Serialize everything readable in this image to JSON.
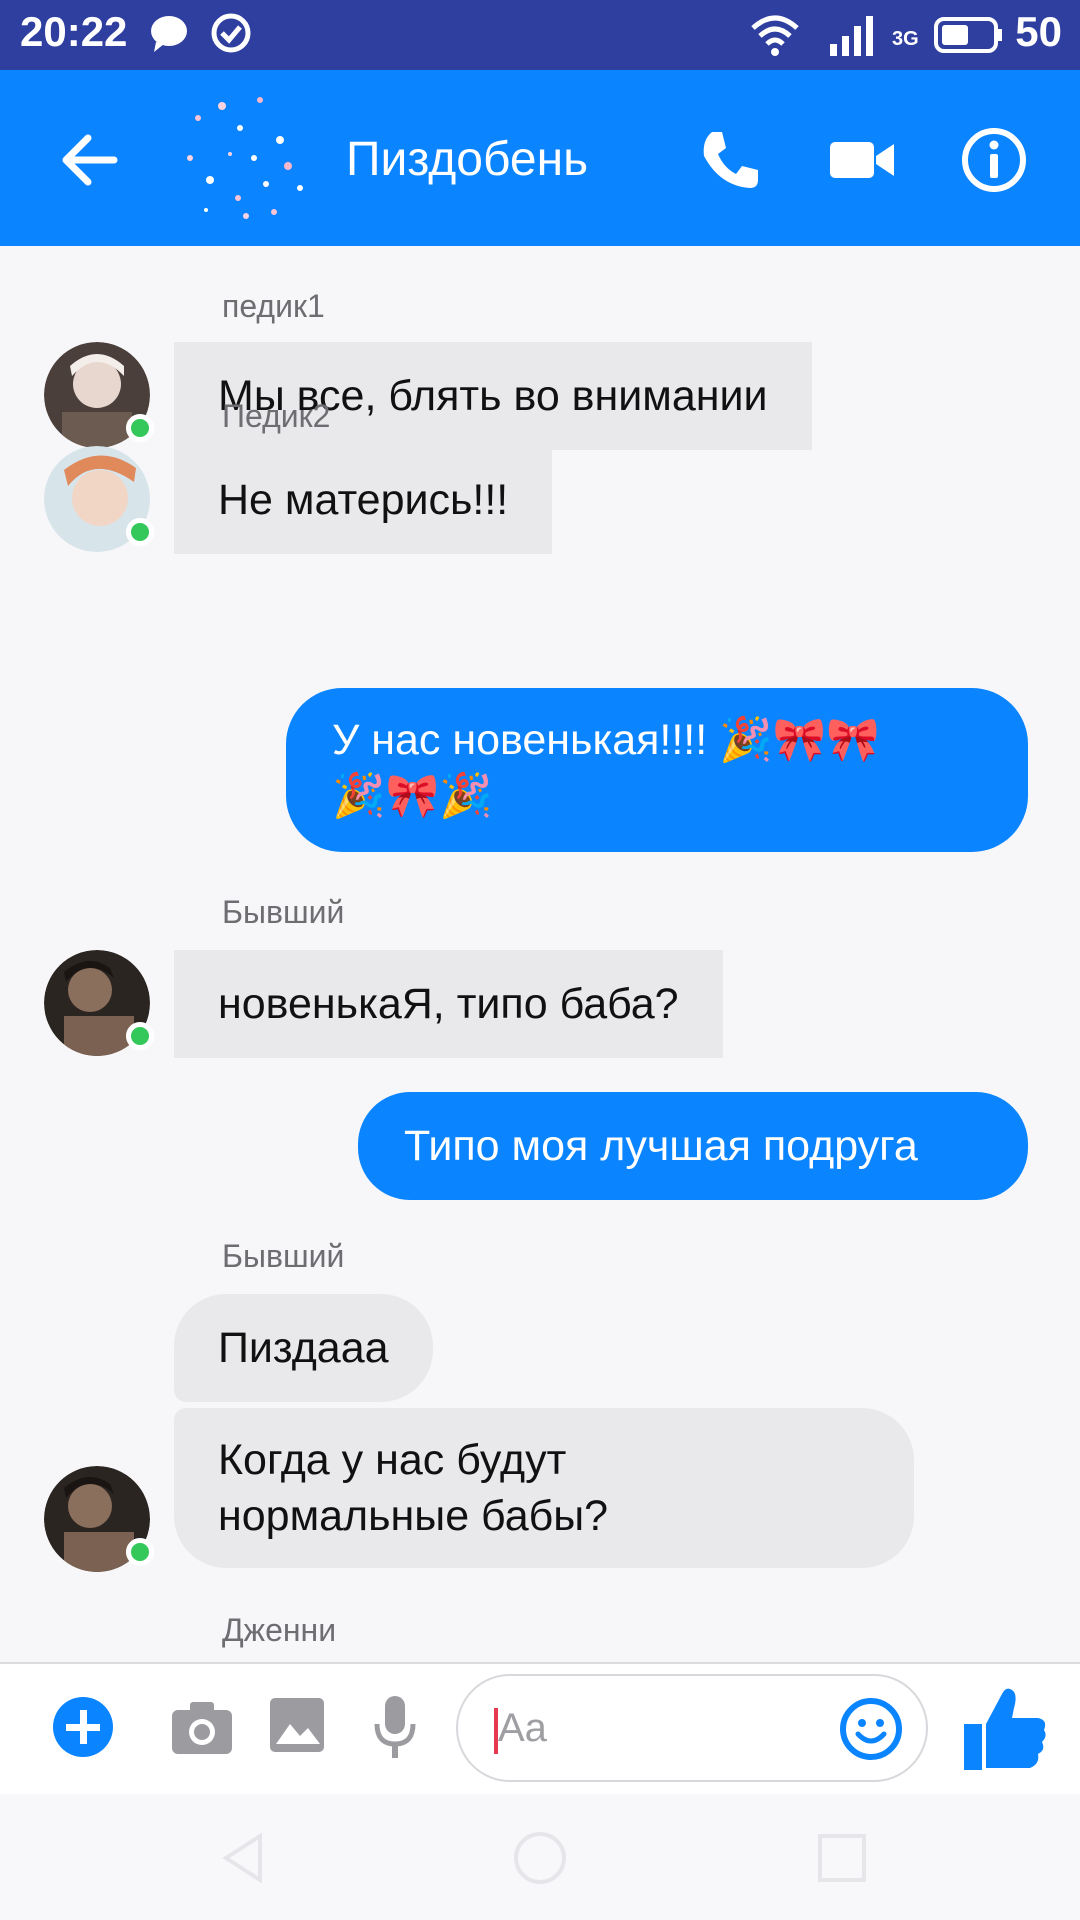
{
  "status_bar": {
    "time": "20:22",
    "network": "3G",
    "battery": "50"
  },
  "header": {
    "title": "Пиздобень"
  },
  "messages": [
    {
      "sender": "педик1",
      "text": "Мы все, блять во внимании"
    },
    {
      "sender": "Педик2",
      "text": "Не матерись!!!"
    },
    {
      "text_line1": "У нас новенькая!!!! 🎉🎀🎀",
      "text_line2": "🎉🎀🎉"
    },
    {
      "sender": "Бывший",
      "text": "новенькаЯ,  типо баба?"
    },
    {
      "text": "Типо моя лучшая подруга"
    },
    {
      "sender": "Бывший",
      "text": "Пиздааа"
    },
    {
      "text_line1": "Когда у нас будут",
      "text_line2": "нормальные бабы?"
    },
    {
      "sender": "Дженни"
    }
  ],
  "composer": {
    "placeholder": "Aa"
  },
  "colors": {
    "status_bar": "#2f3fa0",
    "header": "#0a84ff",
    "outgoing_bubble": "#0a84ff",
    "incoming_bubble": "#e9e9ec",
    "online": "#34c759"
  },
  "icons": {
    "header": [
      "back-arrow-icon",
      "phone-icon",
      "video-camera-icon",
      "info-icon"
    ],
    "composer": [
      "plus-icon",
      "camera-icon",
      "image-icon",
      "microphone-icon",
      "smiley-icon",
      "thumbs-up-icon"
    ]
  }
}
